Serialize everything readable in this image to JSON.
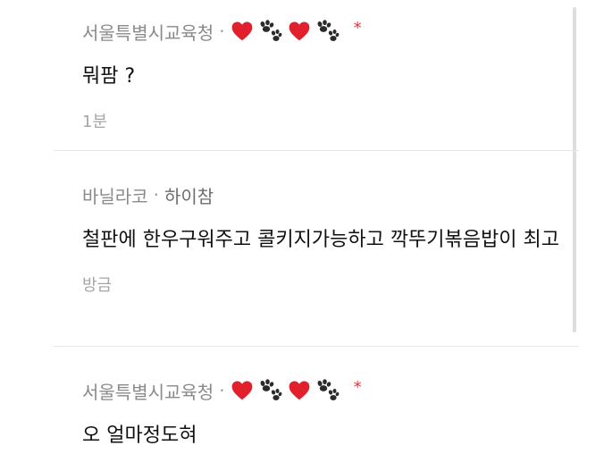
{
  "comments": [
    {
      "author": "서울특별시교육청",
      "separator": "·",
      "nickname": "",
      "star": "*",
      "text": "뭐팜 ?",
      "time": "1분"
    },
    {
      "author": "바닐라코",
      "separator": "·",
      "nickname": "하이참",
      "star": "",
      "text": "철판에 한우구워주고 콜키지가능하고 깍뚜기볶음밥이 최고",
      "time": "방금"
    },
    {
      "author": "서울특별시교육청",
      "separator": "·",
      "nickname": "",
      "star": "*",
      "text": "오 얼마정도혀",
      "time": ""
    }
  ],
  "colors": {
    "heart": "#e0212d",
    "paw": "#2b2b2b",
    "star": "#e8323c",
    "meta_text": "#8a8a8a",
    "body_text": "#111111"
  },
  "icons": [
    "heart-icon",
    "paw-icon"
  ]
}
